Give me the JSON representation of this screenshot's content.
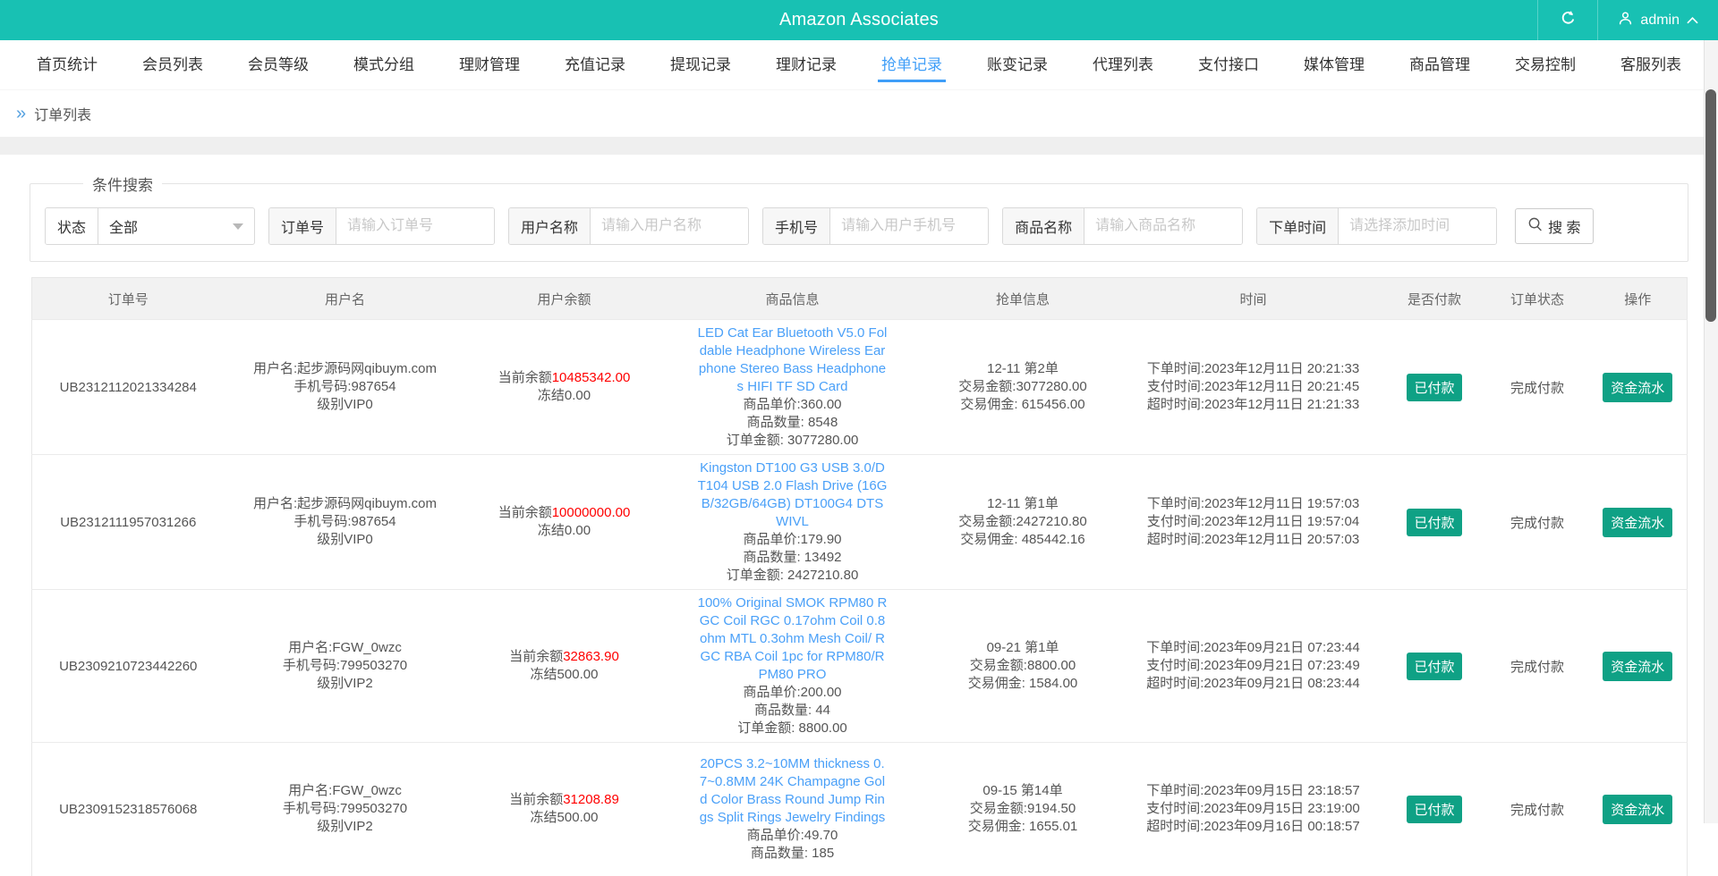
{
  "header": {
    "title": "Amazon Associates",
    "user": "admin"
  },
  "nav": {
    "active_index": 8,
    "tabs": [
      "首页统计",
      "会员列表",
      "会员等级",
      "模式分组",
      "理财管理",
      "充值记录",
      "提现记录",
      "理财记录",
      "抢单记录",
      "账变记录",
      "代理列表",
      "支付接口",
      "媒体管理",
      "商品管理",
      "交易控制",
      "客服列表"
    ]
  },
  "breadcrumb": {
    "arrow": "»",
    "label": "订单列表"
  },
  "search": {
    "legend": "条件搜索",
    "status": {
      "label": "状态",
      "value": "全部"
    },
    "fields": [
      {
        "label": "订单号",
        "placeholder": "请输入订单号"
      },
      {
        "label": "用户名称",
        "placeholder": "请输入用户名称"
      },
      {
        "label": "手机号",
        "placeholder": "请输入用户手机号"
      },
      {
        "label": "商品名称",
        "placeholder": "请输入商品名称"
      },
      {
        "label": "下单时间",
        "placeholder": "请选择添加时间"
      }
    ],
    "button_label": "搜 索"
  },
  "table": {
    "headers": [
      "订单号",
      "用户名",
      "用户余额",
      "商品信息",
      "抢单信息",
      "时间",
      "是否付款",
      "订单状态",
      "操作"
    ],
    "rows": [
      {
        "order_no": "UB2312112021334284",
        "user": [
          "用户名:起步源码网qibuym.com",
          "手机号码:987654",
          "级别VIP0"
        ],
        "balance": {
          "prefix": "当前余额",
          "amount": "10485342.00",
          "frozen": "冻结0.00"
        },
        "product": {
          "title": "LED Cat Ear Bluetooth V5.0 Foldable Headphone Wireless Earphone Stereo Bass Headphones HIFI TF SD Card",
          "price": "商品单价:360.00",
          "qty": "商品数量: 8548",
          "amount": "订单金额: 3077280.00"
        },
        "grab": [
          "12-11 第2单",
          "交易金额:3077280.00",
          "交易佣金: 615456.00"
        ],
        "time": [
          "下单时间:2023年12月11日 20:21:33",
          "支付时间:2023年12月11日 20:21:45",
          "超时时间:2023年12月11日 21:21:33"
        ],
        "paid": "已付款",
        "status": "完成付款",
        "action": "资金流水"
      },
      {
        "order_no": "UB2312111957031266",
        "user": [
          "用户名:起步源码网qibuym.com",
          "手机号码:987654",
          "级别VIP0"
        ],
        "balance": {
          "prefix": "当前余额",
          "amount": "10000000.00",
          "frozen": "冻结0.00"
        },
        "product": {
          "title": "Kingston DT100 G3 USB 3.0/DT104 USB 2.0 Flash Drive (16GB/32GB/64GB) DT100G4 DTSWIVL",
          "price": "商品单价:179.90",
          "qty": "商品数量: 13492",
          "amount": "订单金额: 2427210.80"
        },
        "grab": [
          "12-11 第1单",
          "交易金额:2427210.80",
          "交易佣金: 485442.16"
        ],
        "time": [
          "下单时间:2023年12月11日 19:57:03",
          "支付时间:2023年12月11日 19:57:04",
          "超时时间:2023年12月11日 20:57:03"
        ],
        "paid": "已付款",
        "status": "完成付款",
        "action": "资金流水"
      },
      {
        "order_no": "UB2309210723442260",
        "user": [
          "用户名:FGW_0wzc",
          "手机号码:799503270",
          "级别VIP2"
        ],
        "balance": {
          "prefix": "当前余额",
          "amount": "32863.90",
          "frozen": "冻结500.00"
        },
        "product": {
          "title": "100% Original SMOK RPM80 RGC Coil RGC 0.17ohm Coil 0.8ohm MTL 0.3ohm Mesh Coil/ RGC RBA Coil 1pc for RPM80/RPM80 PRO",
          "price": "商品单价:200.00",
          "qty": "商品数量: 44",
          "amount": "订单金额: 8800.00"
        },
        "grab": [
          "09-21 第1单",
          "交易金额:8800.00",
          "交易佣金: 1584.00"
        ],
        "time": [
          "下单时间:2023年09月21日 07:23:44",
          "支付时间:2023年09月21日 07:23:49",
          "超时时间:2023年09月21日 08:23:44"
        ],
        "paid": "已付款",
        "status": "完成付款",
        "action": "资金流水"
      },
      {
        "order_no": "UB2309152318576068",
        "user": [
          "用户名:FGW_0wzc",
          "手机号码:799503270",
          "级别VIP2"
        ],
        "balance": {
          "prefix": "当前余额",
          "amount": "31208.89",
          "frozen": "冻结500.00"
        },
        "product": {
          "title": "20PCS 3.2~10MM thickness 0.7~0.8MM 24K Champagne Gold Color Brass Round Jump Rings Split Rings Jewelry Findings",
          "price": "商品单价:49.70",
          "qty": "商品数量: 185",
          "amount": ""
        },
        "grab": [
          "09-15 第14单",
          "交易金额:9194.50",
          "交易佣金: 1655.01"
        ],
        "time": [
          "下单时间:2023年09月15日 23:18:57",
          "支付时间:2023年09月15日 23:19:00",
          "超时时间:2023年09月16日 00:18:57"
        ],
        "paid": "已付款",
        "status": "完成付款",
        "action": "资金流水"
      }
    ]
  },
  "colors": {
    "header_bg": "#18c1b3",
    "active_tab_blue": "#3f9ef8",
    "product_link_blue": "#4aa0f8",
    "balance_red": "#ff0000",
    "badge_green": "#0fa185"
  }
}
